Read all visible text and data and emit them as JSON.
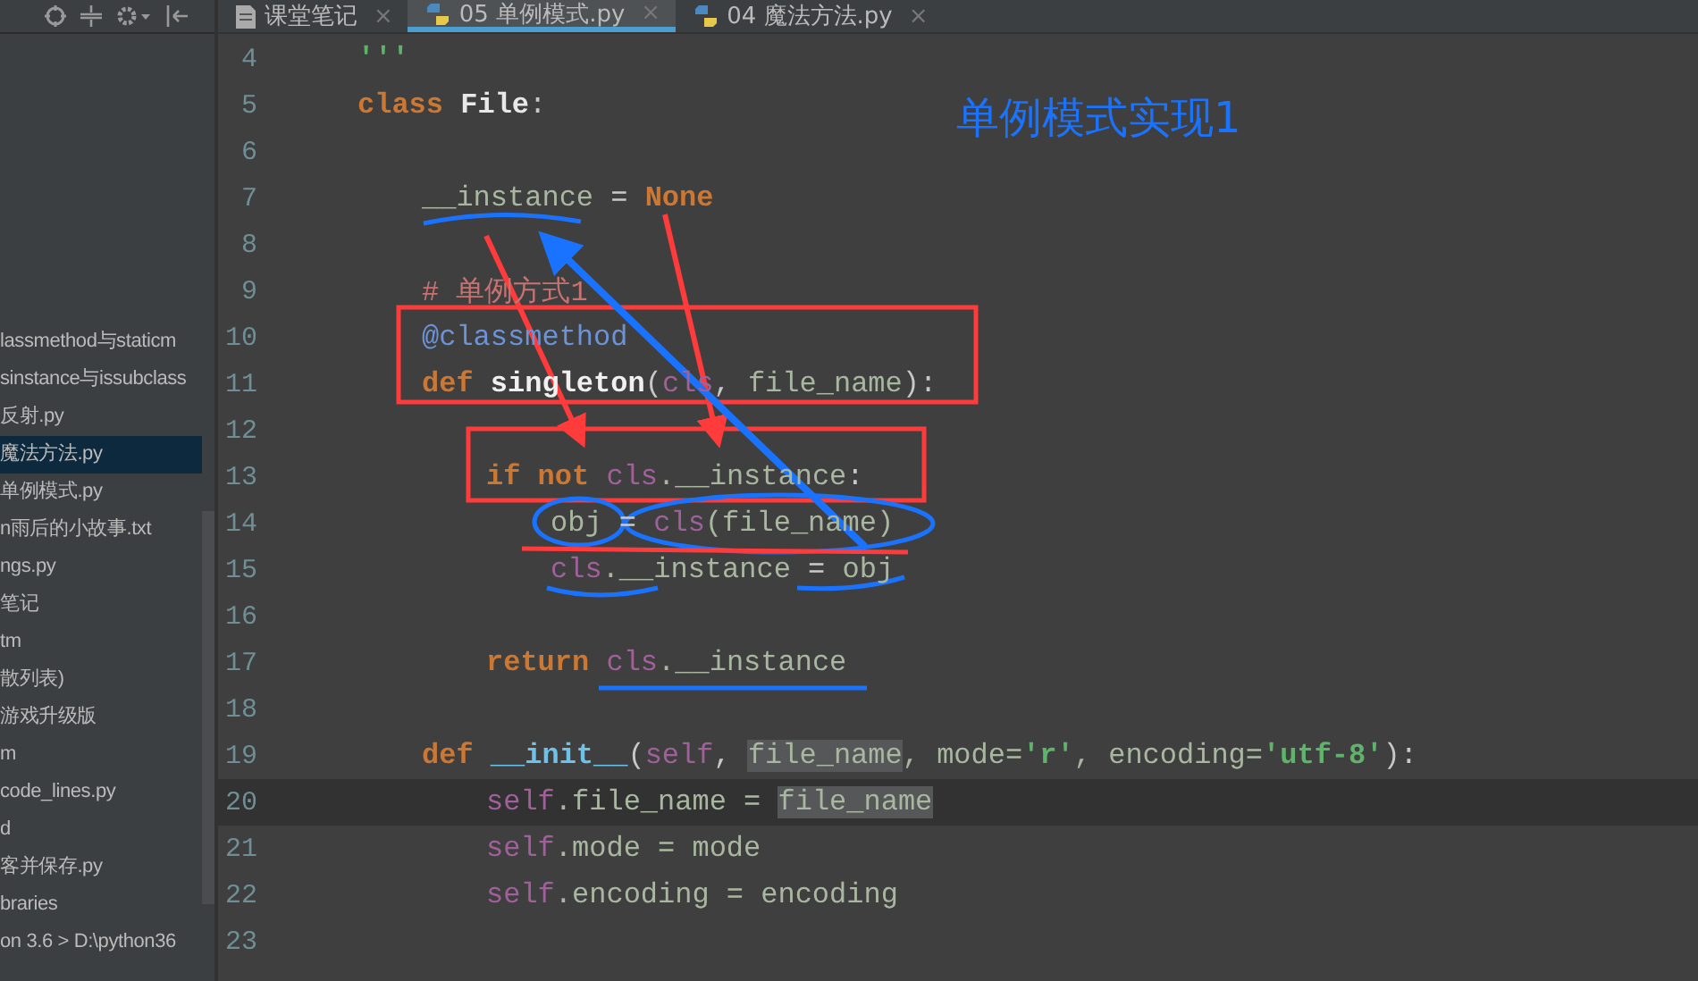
{
  "tabs": [
    {
      "label": "课堂笔记",
      "kind": "note",
      "close": "×",
      "selected": false
    },
    {
      "label": "05 单例模式.py",
      "kind": "python",
      "close": "×",
      "selected": true
    },
    {
      "label": "04 魔法方法.py",
      "kind": "python",
      "close": "×",
      "selected": false
    }
  ],
  "sidebar": {
    "items": [
      {
        "label": "lassmethod与staticm",
        "selected": false
      },
      {
        "label": "sinstance与issubclass",
        "selected": false
      },
      {
        "label": "反射.py",
        "selected": false
      },
      {
        "label": "魔法方法.py",
        "selected": true
      },
      {
        "label": "单例模式.py",
        "selected": false
      },
      {
        "label": "n雨后的小故事.txt",
        "selected": false
      },
      {
        "label": "ngs.py",
        "selected": false
      },
      {
        "label": "笔记",
        "selected": false
      },
      {
        "label": "tm",
        "selected": false
      },
      {
        "label": "散列表)",
        "selected": false
      },
      {
        "label": "游戏升级版",
        "selected": false
      },
      {
        "label": "m",
        "selected": false
      },
      {
        "label": "code_lines.py",
        "selected": false
      },
      {
        "label": "d",
        "selected": false
      },
      {
        "label": "客并保存.py",
        "selected": false
      },
      {
        "label": "braries",
        "selected": false
      },
      {
        "label": "on 3.6 >  D:\\python36",
        "selected": false
      }
    ]
  },
  "editor": {
    "lines": [
      {
        "number": "4",
        "current": false,
        "tokens": [
          {
            "text": "'''",
            "kind": "string"
          }
        ]
      },
      {
        "number": "5",
        "current": false,
        "tokens": [
          {
            "text": "class ",
            "kind": "keyword"
          },
          {
            "text": "File",
            "kind": "classname"
          },
          {
            "text": ":",
            "kind": "plain"
          }
        ],
        "children": [
          {
            "number": "6",
            "current": false
          },
          {
            "number": "7",
            "current": false,
            "tokens": [
              {
                "text": "__instance",
                "kind": "name"
              },
              {
                "text": " = ",
                "kind": "plain"
              },
              {
                "text": "None",
                "kind": "keyword"
              }
            ]
          },
          {
            "number": "8",
            "current": false
          },
          {
            "number": "9",
            "current": false,
            "tokens": [
              {
                "text": "# 单例方式1",
                "kind": "comment"
              }
            ]
          },
          {
            "number": "10",
            "current": false,
            "tokens": [
              {
                "text": "@classmethod",
                "kind": "decorator"
              }
            ]
          },
          {
            "number": "11",
            "current": false,
            "tokens": [
              {
                "text": "def ",
                "kind": "keyword"
              },
              {
                "text": "singleton",
                "kind": "func"
              },
              {
                "text": "(",
                "kind": "plain"
              },
              {
                "text": "cls",
                "kind": "self"
              },
              {
                "text": ", ",
                "kind": "plain"
              },
              {
                "text": "file_name",
                "kind": "name"
              },
              {
                "text": "):",
                "kind": "plain"
              }
            ],
            "children": [
              {
                "number": "12",
                "current": false
              },
              {
                "number": "13",
                "current": false,
                "tokens": [
                  {
                    "text": "if not ",
                    "kind": "keyword"
                  },
                  {
                    "text": "cls",
                    "kind": "self"
                  },
                  {
                    "text": ".__instance",
                    "kind": "name"
                  },
                  {
                    "text": ":",
                    "kind": "plain"
                  }
                ],
                "children": [
                  {
                    "number": "14",
                    "current": false,
                    "tokens": [
                      {
                        "text": "obj",
                        "kind": "name"
                      },
                      {
                        "text": " = ",
                        "kind": "plain"
                      },
                      {
                        "text": "cls",
                        "kind": "self"
                      },
                      {
                        "text": "(file_name)",
                        "kind": "name"
                      }
                    ]
                  },
                  {
                    "number": "15",
                    "current": false,
                    "tokens": [
                      {
                        "text": "cls",
                        "kind": "self"
                      },
                      {
                        "text": ".__instance",
                        "kind": "name"
                      },
                      {
                        "text": " = ",
                        "kind": "plain"
                      },
                      {
                        "text": "obj",
                        "kind": "name"
                      }
                    ]
                  }
                ]
              },
              {
                "number": "16",
                "current": false
              },
              {
                "number": "17",
                "current": false,
                "tokens": [
                  {
                    "text": "return ",
                    "kind": "keyword"
                  },
                  {
                    "text": "cls",
                    "kind": "self"
                  },
                  {
                    "text": ".__instance",
                    "kind": "name"
                  }
                ]
              }
            ]
          },
          {
            "number": "18",
            "current": false
          },
          {
            "number": "19",
            "current": false,
            "tokens": [
              {
                "text": "def ",
                "kind": "keyword"
              },
              {
                "text": "__init__",
                "kind": "magic"
              },
              {
                "text": "(",
                "kind": "plain"
              },
              {
                "text": "self",
                "kind": "self"
              },
              {
                "text": ", ",
                "kind": "plain"
              },
              {
                "text": "file_name",
                "kind": "ref"
              },
              {
                "text": ", mode=",
                "kind": "name"
              },
              {
                "text": "'r'",
                "kind": "string"
              },
              {
                "text": ", encoding=",
                "kind": "name"
              },
              {
                "text": "'utf-8'",
                "kind": "string"
              },
              {
                "text": "):",
                "kind": "plain"
              }
            ],
            "children": [
              {
                "number": "20",
                "current": true,
                "tokens": [
                  {
                    "text": "self",
                    "kind": "self"
                  },
                  {
                    "text": ".file_name = ",
                    "kind": "name"
                  },
                  {
                    "text": "file_name",
                    "kind": "ref"
                  }
                ]
              },
              {
                "number": "21",
                "current": false,
                "tokens": [
                  {
                    "text": "self",
                    "kind": "self"
                  },
                  {
                    "text": ".mode = mode",
                    "kind": "name"
                  }
                ]
              },
              {
                "number": "22",
                "current": false,
                "tokens": [
                  {
                    "text": "self",
                    "kind": "self"
                  },
                  {
                    "text": ".encoding = encoding",
                    "kind": "name"
                  }
                ]
              }
            ]
          },
          {
            "number": "23",
            "current": false
          }
        ]
      }
    ]
  },
  "annotation_title": "单例模式实现1"
}
